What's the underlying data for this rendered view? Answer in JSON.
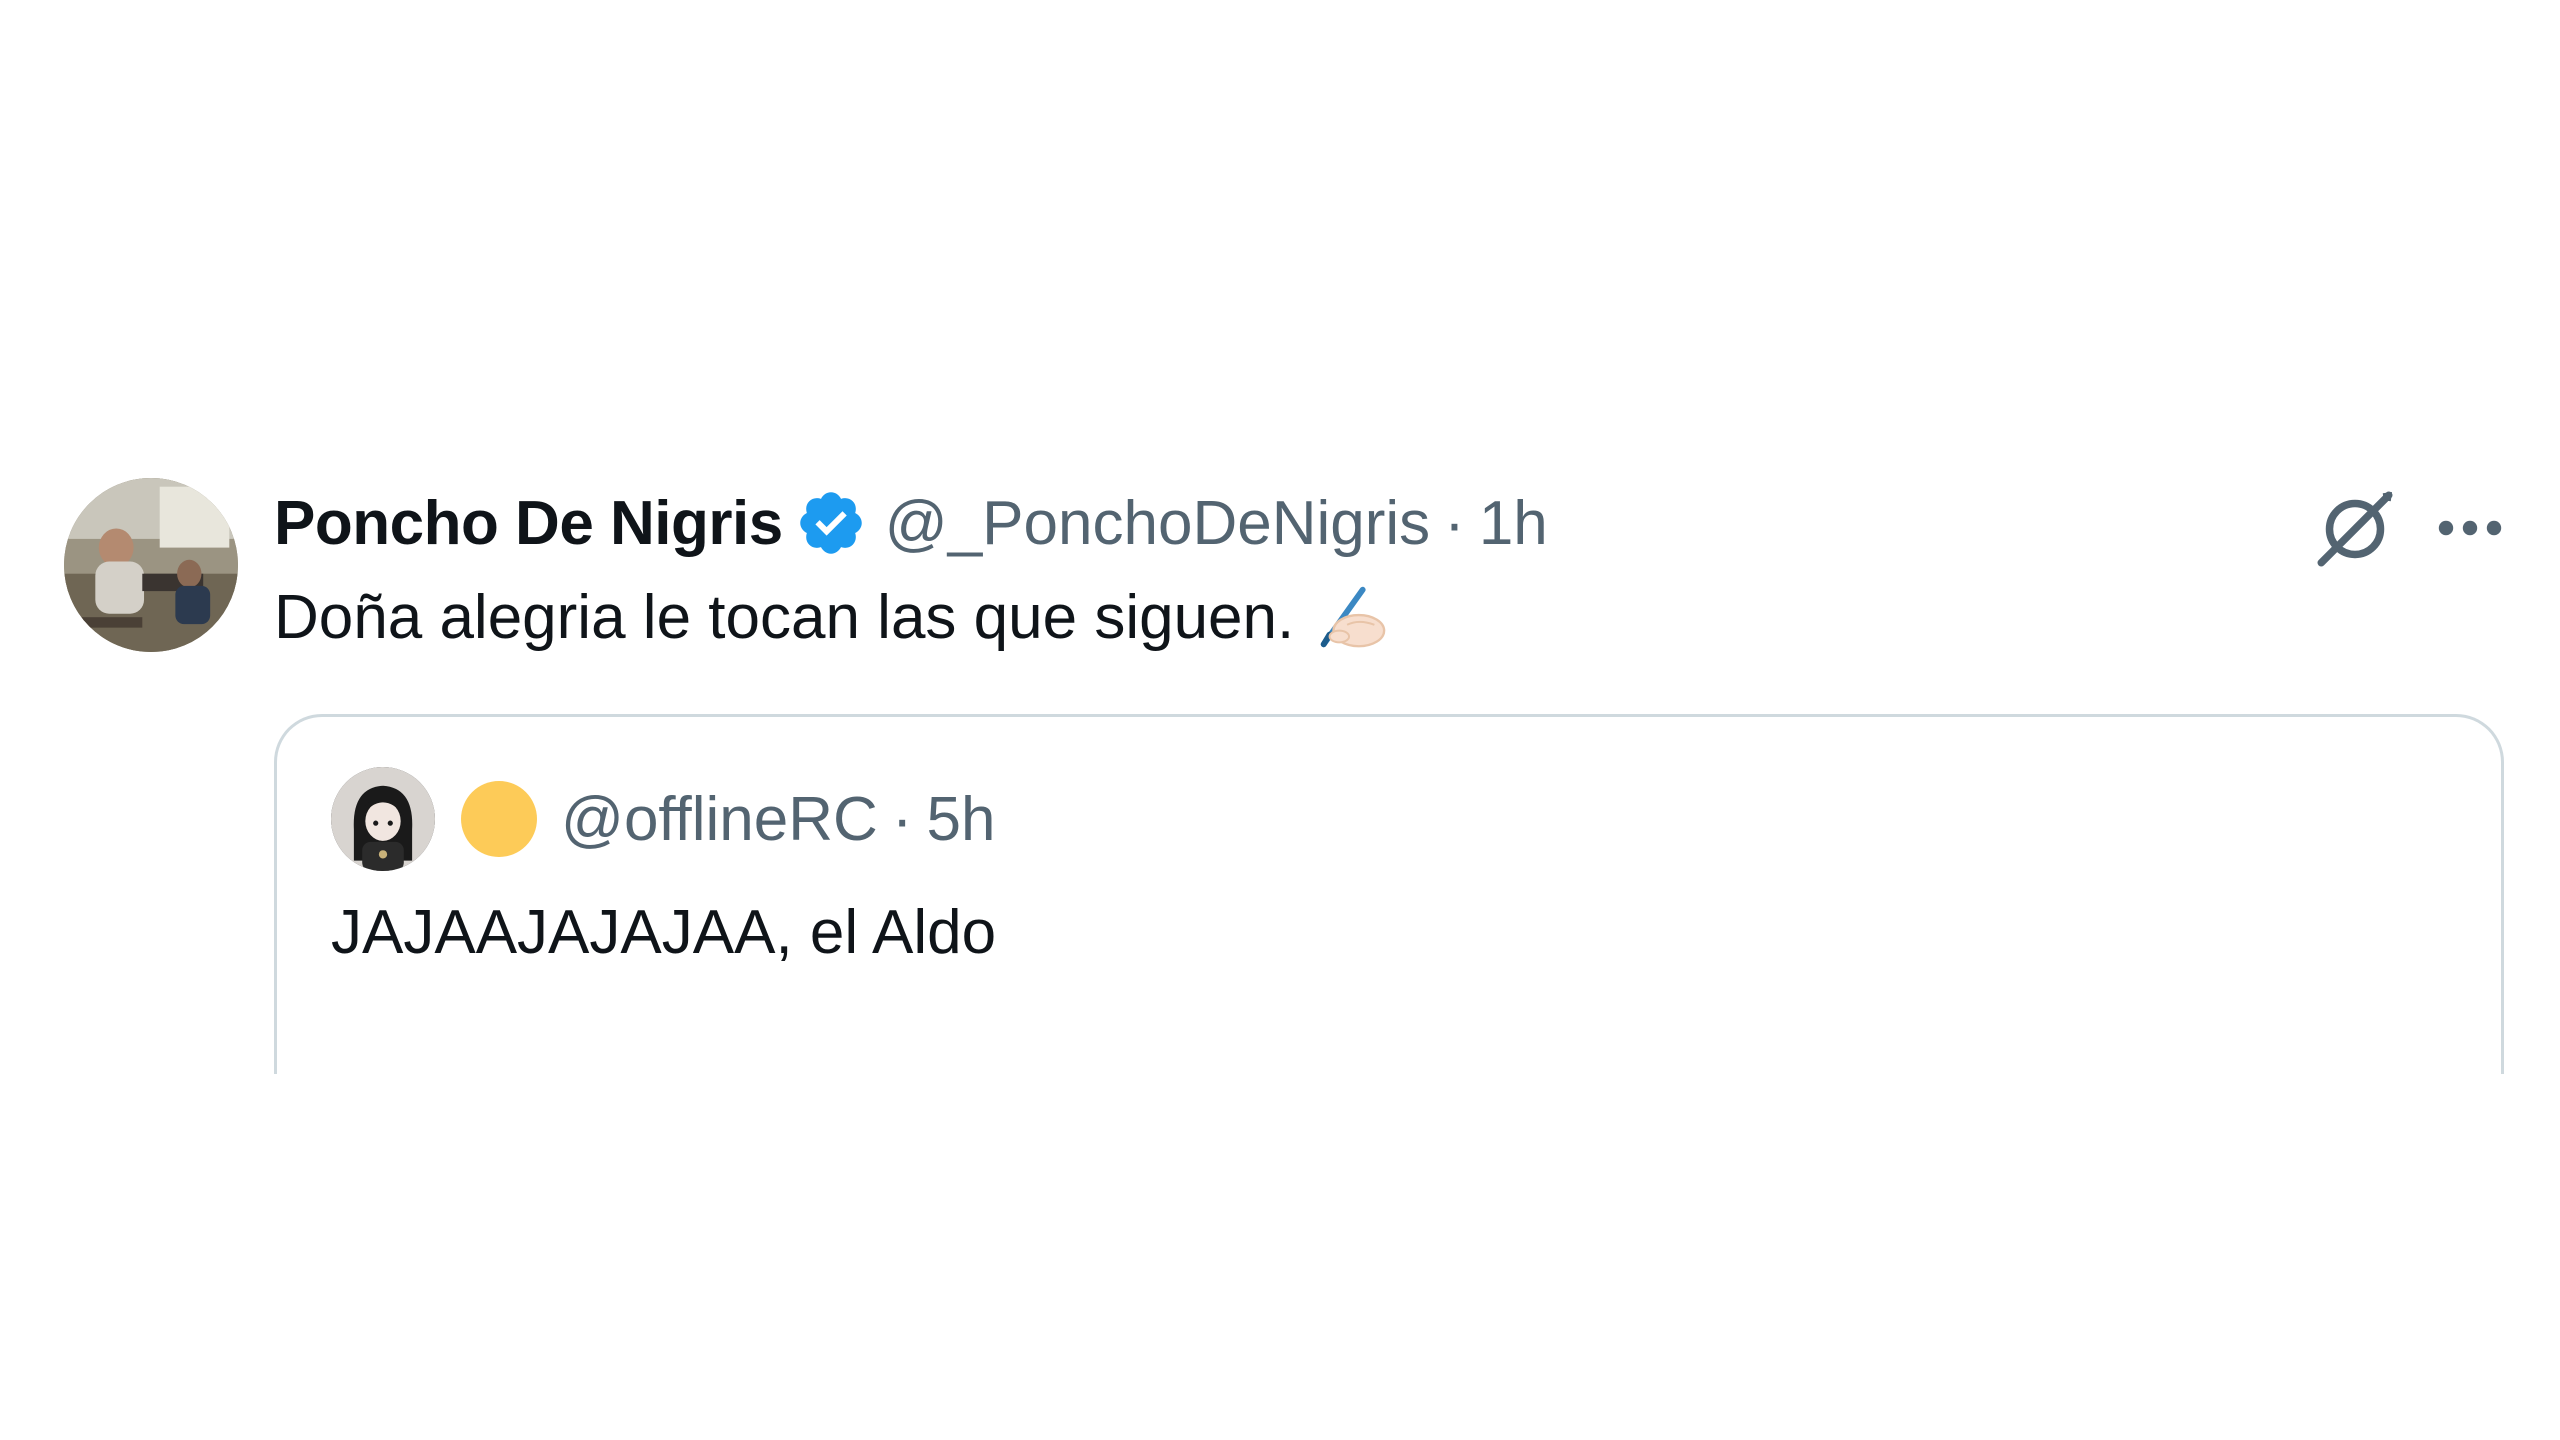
{
  "tweet": {
    "author": {
      "display_name": "Poncho De Nigris",
      "handle": "@_PonchoDeNigris",
      "verified": true,
      "avatar_icon": "profile-photo"
    },
    "separator": "·",
    "time": "1h",
    "text": "Doña alegria le tocan las que siguen.",
    "emoji": "writing-hand-emoji",
    "actions": {
      "grok_icon": "grok-icon",
      "more_icon": "more-options-icon"
    },
    "verified_color": "#1d9bf0"
  },
  "quote": {
    "handle": "@offlineRC",
    "separator": "·",
    "time": "5h",
    "text": "JAJAAJAJAJAA, el Aldo",
    "badge_color": "#fdcb58"
  },
  "colors": {
    "text_primary": "#0f1419",
    "text_secondary": "#536471",
    "border": "#cfd9de"
  }
}
